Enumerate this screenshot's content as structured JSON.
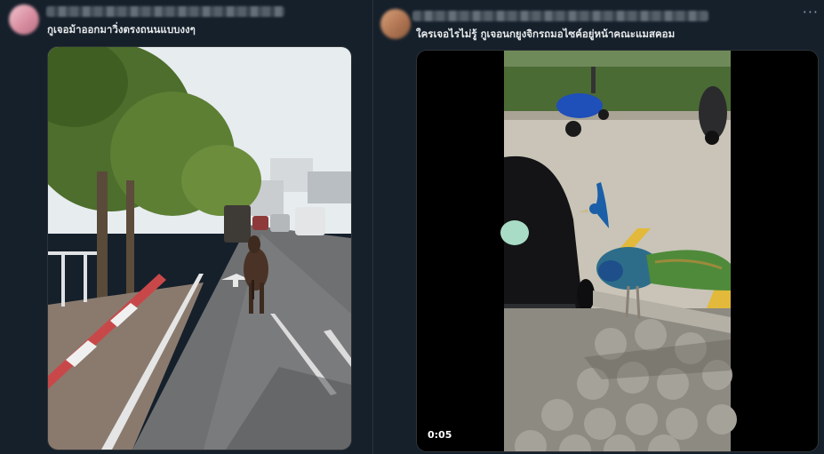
{
  "tweets": [
    {
      "avatar_icon": "user-avatar-blurred",
      "caption": "กูเจอม้าออกมาวิ่งตรงถนนแบบงงๆ",
      "media": {
        "type": "photo",
        "subject": "horse-on-road-photo"
      }
    },
    {
      "avatar_icon": "user-avatar-blurred",
      "caption": "ใครเจอไรไม่รู้ กูเจอนกยูงจิกรถมอไซค์อยู่หน้าคณะแมสคอม",
      "media": {
        "type": "video",
        "subject": "peacock-motorbike-video",
        "duration": "0:05"
      },
      "more_icon": "more-options-icon",
      "more_label": "···"
    }
  ],
  "colors": {
    "background": "#15202b",
    "text": "#e7e9ea",
    "border": "#2f3336"
  }
}
